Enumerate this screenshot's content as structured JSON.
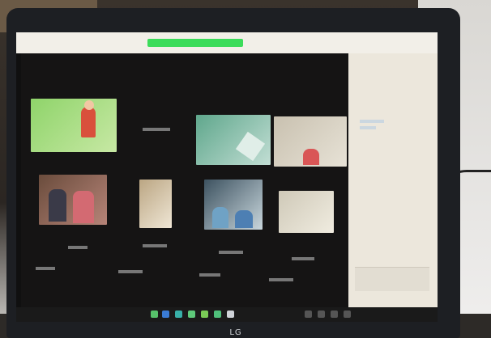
{
  "scene": {
    "description_free": true,
    "colors": {
      "screen_bg": "#101010",
      "zoom_header": "#f2efe8",
      "active_speaker_bar": "#3cdc5a",
      "chat_panel": "#ece7dc",
      "laptop_bezel": "#1d1f23"
    }
  },
  "laptop": {
    "brand": "LG"
  },
  "tiles": [
    {
      "name": "",
      "colors": [
        "#8fd46a",
        "#c7e8a4"
      ]
    },
    {
      "name": "",
      "colors": [
        "#5fa78c",
        "#c2ded4"
      ]
    },
    {
      "name": "",
      "colors": [
        "#c9c1b0",
        "#e7e2d6"
      ]
    },
    {
      "name": "",
      "colors": [
        "#6a4c3c",
        "#b68478"
      ]
    },
    {
      "name": "",
      "colors": [
        "#bba683",
        "#efe6d5"
      ]
    },
    {
      "name": "",
      "colors": [
        "#3d5260",
        "#c8d6dc"
      ]
    },
    {
      "name": "",
      "colors": [
        "#cfc9b8",
        "#f0ece0"
      ]
    }
  ],
  "toolbar": {
    "icons": [
      "mic-icon",
      "video-icon",
      "security-icon",
      "participants-icon",
      "chat-icon",
      "share-icon",
      "record-icon",
      "reactions-icon"
    ]
  }
}
